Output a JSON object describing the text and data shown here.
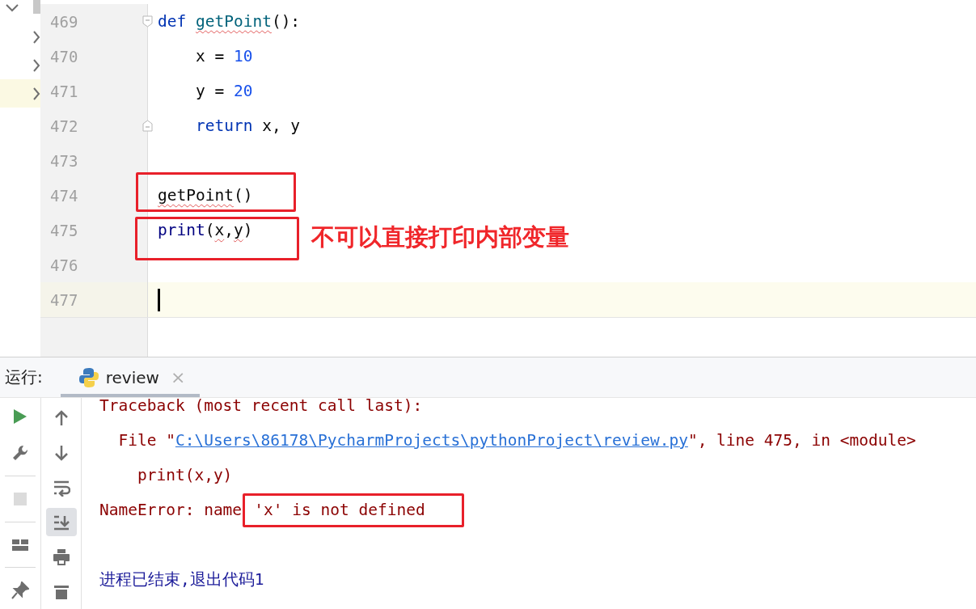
{
  "editor": {
    "tree_toggles": [
      {
        "expanded": true
      },
      {
        "expanded": false
      },
      {
        "expanded": false
      },
      {
        "expanded": false,
        "selected": true
      }
    ],
    "lines": [
      {
        "number": "469",
        "kind": "fold-start",
        "tokens": [
          {
            "text": "def ",
            "kind": "keyword"
          },
          {
            "text": "getPoint",
            "kind": "function",
            "squiggle": true
          },
          {
            "text": "():",
            "kind": "plain"
          }
        ]
      },
      {
        "number": "470",
        "tokens": [
          {
            "text": "    x = ",
            "kind": "plain"
          },
          {
            "text": "10",
            "kind": "number"
          }
        ]
      },
      {
        "number": "471",
        "tokens": [
          {
            "text": "    y = ",
            "kind": "plain"
          },
          {
            "text": "20",
            "kind": "number"
          }
        ]
      },
      {
        "number": "472",
        "kind": "fold-end",
        "tokens": [
          {
            "text": "    return",
            "kind": "keyword"
          },
          {
            "text": " x, y",
            "kind": "plain"
          }
        ]
      },
      {
        "number": "473"
      },
      {
        "number": "474",
        "tokens": [
          {
            "text": "getPoint",
            "kind": "plain",
            "squiggle": true
          },
          {
            "text": "()",
            "kind": "plain"
          }
        ]
      },
      {
        "number": "475",
        "tokens": [
          {
            "text": "print",
            "kind": "builtin"
          },
          {
            "text": "(",
            "kind": "plain"
          },
          {
            "text": "x",
            "kind": "plain",
            "squiggle": true
          },
          {
            "text": ",",
            "kind": "plain"
          },
          {
            "text": "y",
            "kind": "plain",
            "squiggle": true
          },
          {
            "text": ")",
            "kind": "plain"
          }
        ]
      },
      {
        "number": "476"
      },
      {
        "number": "477",
        "current": true,
        "caret": true
      }
    ],
    "annotation": "不可以直接打印内部变量"
  },
  "run_panel": {
    "label": "运行:",
    "tabs": [
      {
        "label": "review",
        "selected": true,
        "close": "×"
      }
    ],
    "side_toolbar": [
      {
        "disabled": false
      },
      {
        "disabled": false
      },
      {
        "disabled": true
      },
      {
        "disabled": false
      },
      {
        "disabled": false
      }
    ],
    "output_toolbar": [
      {
        "on": false
      },
      {
        "on": false
      },
      {
        "on": false
      },
      {
        "on": true
      },
      {
        "on": false
      },
      {
        "on": false
      }
    ],
    "output": [
      {
        "kind": "error",
        "parts": [
          {
            "text": "Traceback (most recent call last):",
            "kind": "plain"
          }
        ]
      },
      {
        "kind": "error",
        "parts": [
          {
            "text": "  File \"",
            "kind": "plain"
          },
          {
            "text": "C:\\Users\\86178\\PycharmProjects\\pythonProject\\review.py",
            "kind": "link"
          },
          {
            "text": "\", line 475, in <module>",
            "kind": "plain"
          }
        ]
      },
      {
        "kind": "error",
        "parts": [
          {
            "text": "    print(x,y)",
            "kind": "plain"
          }
        ]
      },
      {
        "kind": "error",
        "parts": [
          {
            "text": "NameError: name",
            "kind": "plain"
          },
          {
            "text": "'x' is not defined",
            "kind": "plain"
          }
        ]
      },
      {
        "kind": "info",
        "parts": [
          {
            "text": "进程已结束,退出代码1",
            "kind": "plain"
          }
        ]
      }
    ]
  }
}
